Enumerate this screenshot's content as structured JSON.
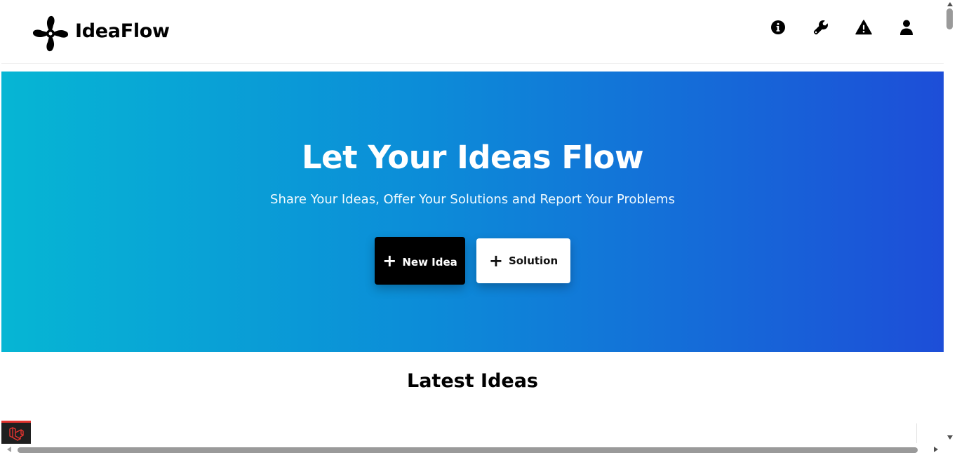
{
  "header": {
    "brand": "IdeaFlow",
    "logo_icon": "fan-icon",
    "nav_icons": [
      "info-icon",
      "wrench-icon",
      "warning-icon",
      "user-icon"
    ]
  },
  "hero": {
    "title": "Let Your Ideas Flow",
    "subtitle": "Share Your Ideas, Offer Your Solutions and Report Your Problems",
    "new_idea_label": "New Idea",
    "solution_label": "Solution",
    "plus_symbol": "+",
    "gradient_start": "#06b6d4",
    "gradient_end": "#1d4ed8"
  },
  "latest": {
    "title": "Latest Ideas"
  },
  "debugbar": {
    "icon": "laravel-icon",
    "accent": "#e3342f"
  }
}
